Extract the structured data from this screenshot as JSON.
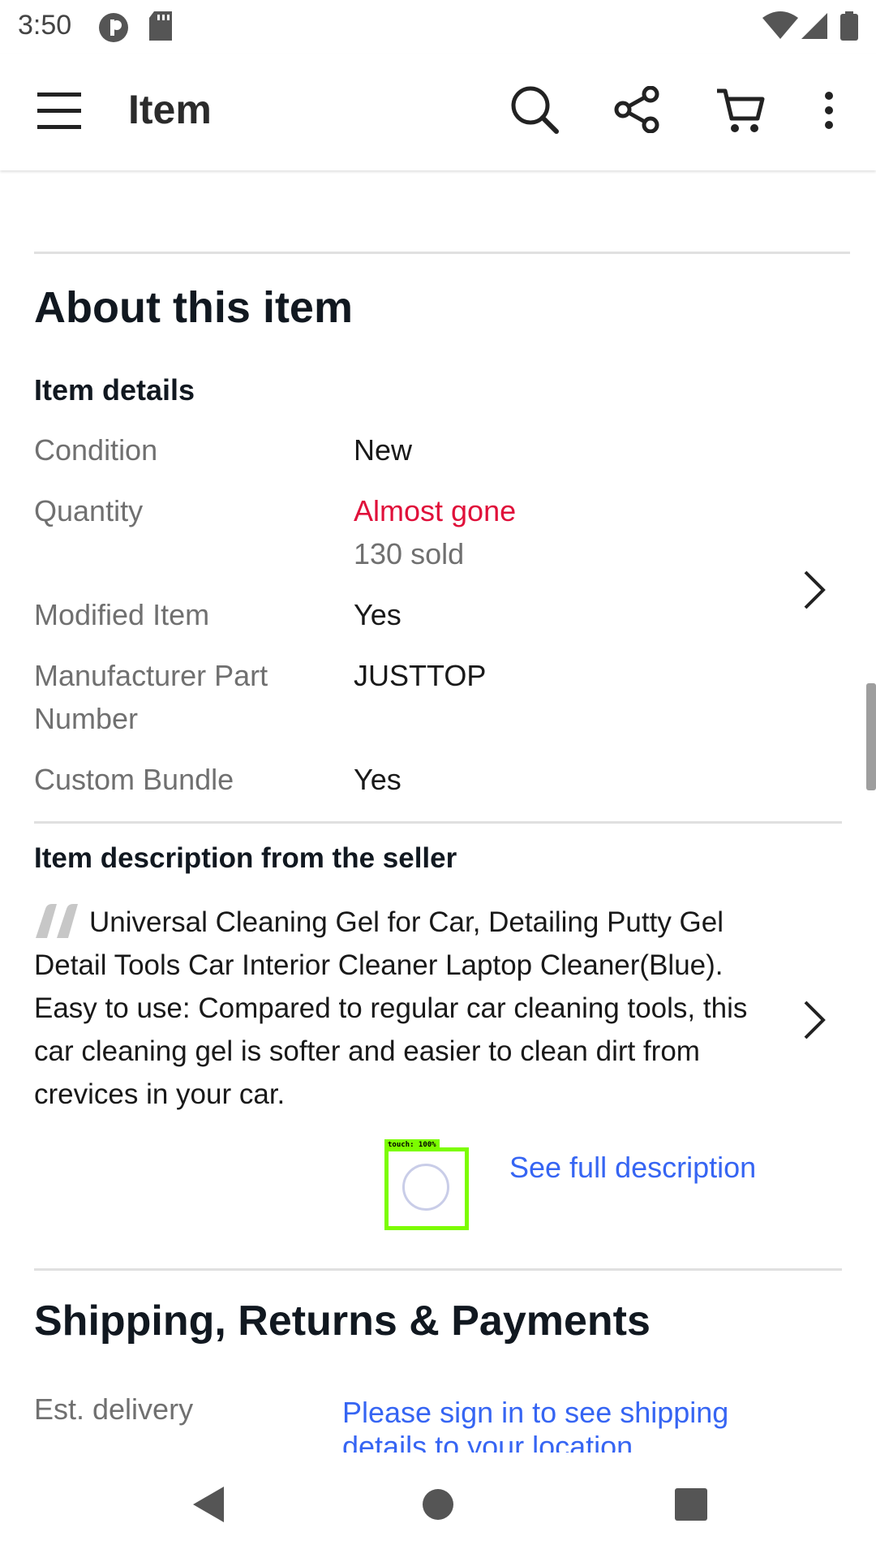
{
  "status_bar": {
    "time": "3:50"
  },
  "app_bar": {
    "title": "Item"
  },
  "about": {
    "title": "About this item",
    "item_details_heading": "Item details",
    "rows": [
      {
        "label": "Condition",
        "value": "New"
      },
      {
        "label": "Quantity",
        "value": "Almost gone",
        "subvalue": "130 sold"
      },
      {
        "label": "Modified Item",
        "value": "Yes"
      },
      {
        "label": "Manufacturer Part Number",
        "label_line1": "Manufacturer Part",
        "label_line2": "Number",
        "value": "JUSTTOP"
      },
      {
        "label": "Custom Bundle",
        "value": "Yes"
      }
    ]
  },
  "description": {
    "heading": "Item description from the seller",
    "text": "Universal Cleaning Gel for Car, Detailing Putty Gel Detail Tools Car Interior Cleaner Laptop Cleaner(Blue). Easy to use: Compared to regular car cleaning tools, this car cleaning gel is softer and easier to clean dirt from crevices in your car.",
    "see_full": "See full description"
  },
  "touch_overlay": {
    "label": "touch: 100%"
  },
  "shipping": {
    "title": "Shipping, Returns & Payments",
    "est_delivery_label": "Est. delivery",
    "est_delivery_line1": "Please sign in to see shipping",
    "est_delivery_line2": "details to your location"
  },
  "colors": {
    "accent_link": "#3665f3",
    "alert_red": "#e0103a",
    "touch_green": "#7cfc00"
  }
}
